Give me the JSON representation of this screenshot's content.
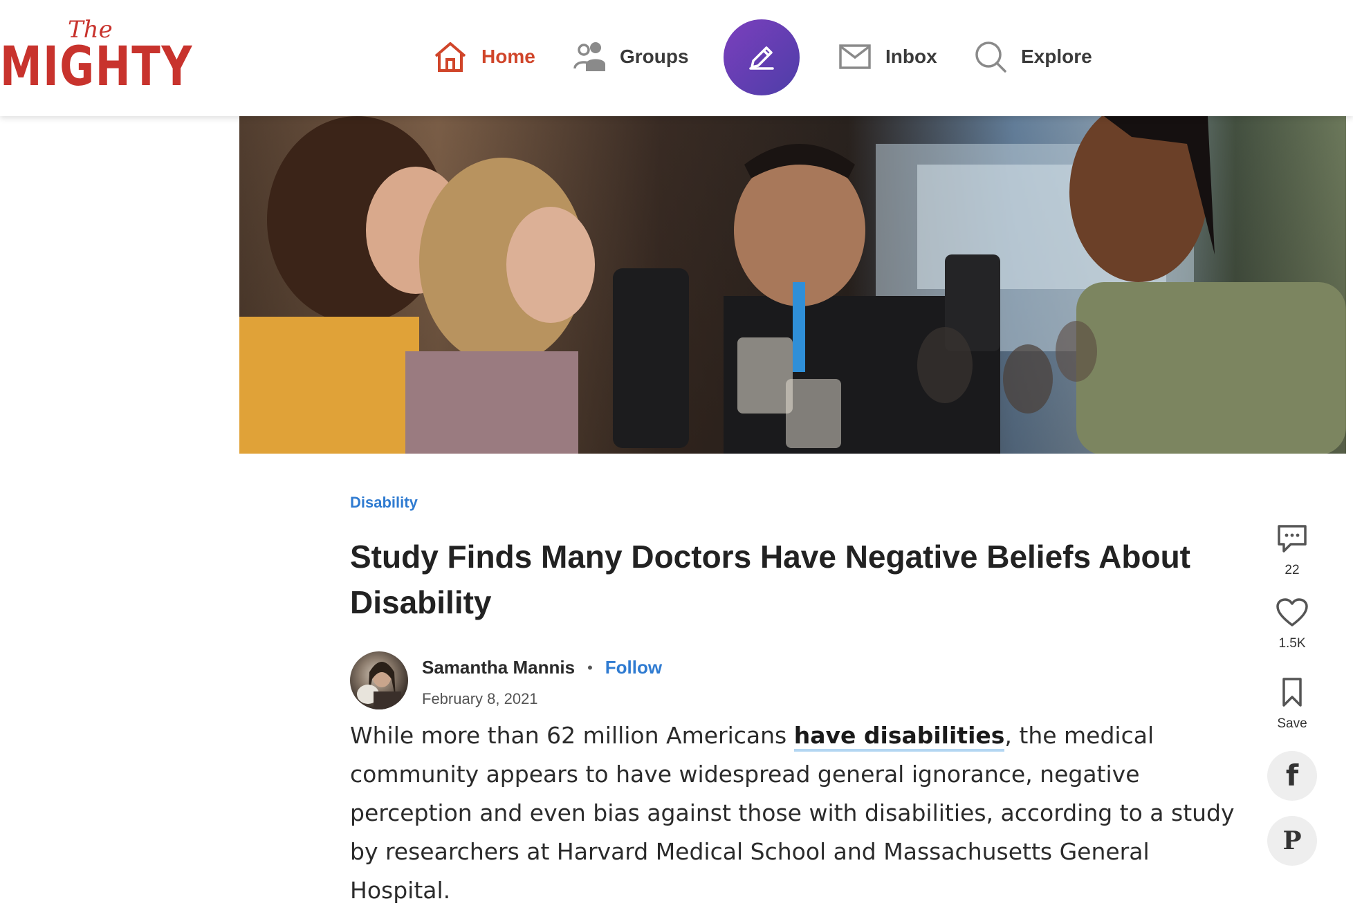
{
  "brand": {
    "logo_top": "The",
    "logo_main": "MIGHTY"
  },
  "nav": {
    "home": {
      "label": "Home",
      "icon": "home-icon"
    },
    "groups": {
      "label": "Groups",
      "icon": "people-icon"
    },
    "compose": {
      "icon": "pencil-icon"
    },
    "inbox": {
      "label": "Inbox",
      "icon": "envelope-icon"
    },
    "explore": {
      "label": "Explore",
      "icon": "search-icon"
    }
  },
  "colors": {
    "brand_red": "#c8332d",
    "active_orange": "#d0452a",
    "link_blue": "#2f7bd1",
    "compose_purple": "#6b3fb8"
  },
  "article": {
    "category": "Disability",
    "title": "Study Finds Many Doctors Have Negative Beliefs About Disability",
    "author": "Samantha Mannis",
    "follow_label": "Follow",
    "date": "February 8, 2021",
    "body_before": "While more than 62 million Americans ",
    "body_link": "have disabilities",
    "body_after": ", the medical community appears to have widespread general ignorance, negative perception and even bias against those with disabilities, according to a study by researchers at Harvard Medical School and Massachusetts General Hospital."
  },
  "rail": {
    "comments": {
      "icon": "comment-icon",
      "count": "22"
    },
    "likes": {
      "icon": "heart-icon",
      "count": "1.5K"
    },
    "save": {
      "icon": "bookmark-icon",
      "label": "Save"
    },
    "facebook": {
      "icon": "facebook-icon",
      "glyph": "f"
    },
    "pinterest": {
      "icon": "pinterest-icon",
      "glyph": "P"
    }
  }
}
